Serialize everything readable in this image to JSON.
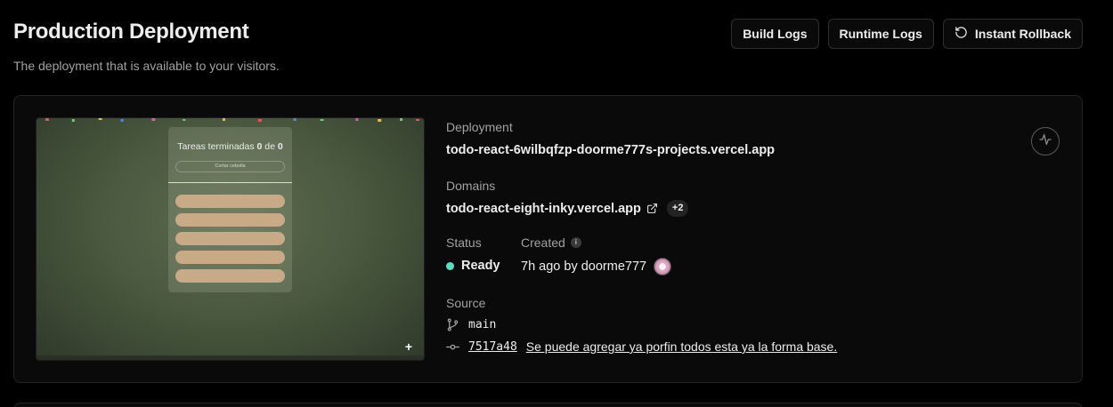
{
  "header": {
    "title": "Production Deployment",
    "subtitle": "The deployment that is available to your visitors."
  },
  "toolbar": {
    "build_logs": "Build Logs",
    "runtime_logs": "Runtime Logs",
    "instant_rollback": "Instant Rollback"
  },
  "preview": {
    "heading_prefix": "Tareas terminadas",
    "completed": "0",
    "heading_sep": "de",
    "total": "0",
    "input_placeholder": "Cortar cebolla",
    "plus": "+"
  },
  "deployment": {
    "label": "Deployment",
    "url": "todo-react-6wilbqfzp-doorme777s-projects.vercel.app"
  },
  "domains": {
    "label": "Domains",
    "primary": "todo-react-eight-inky.vercel.app",
    "extra_count": "+2"
  },
  "status": {
    "label": "Status",
    "value": "Ready",
    "color": "#50e3c2"
  },
  "created": {
    "label": "Created",
    "info_glyph": "i",
    "value": "7h ago by doorme777"
  },
  "source": {
    "label": "Source",
    "branch": "main",
    "commit_hash": "7517a48",
    "commit_message": "Se puede agregar ya porfin todos esta ya la forma base."
  },
  "icons": {
    "rollback": "rotate-ccw-icon",
    "external": "external-link-icon",
    "branch": "git-branch-icon",
    "commit": "git-commit-icon",
    "activity": "activity-icon"
  }
}
